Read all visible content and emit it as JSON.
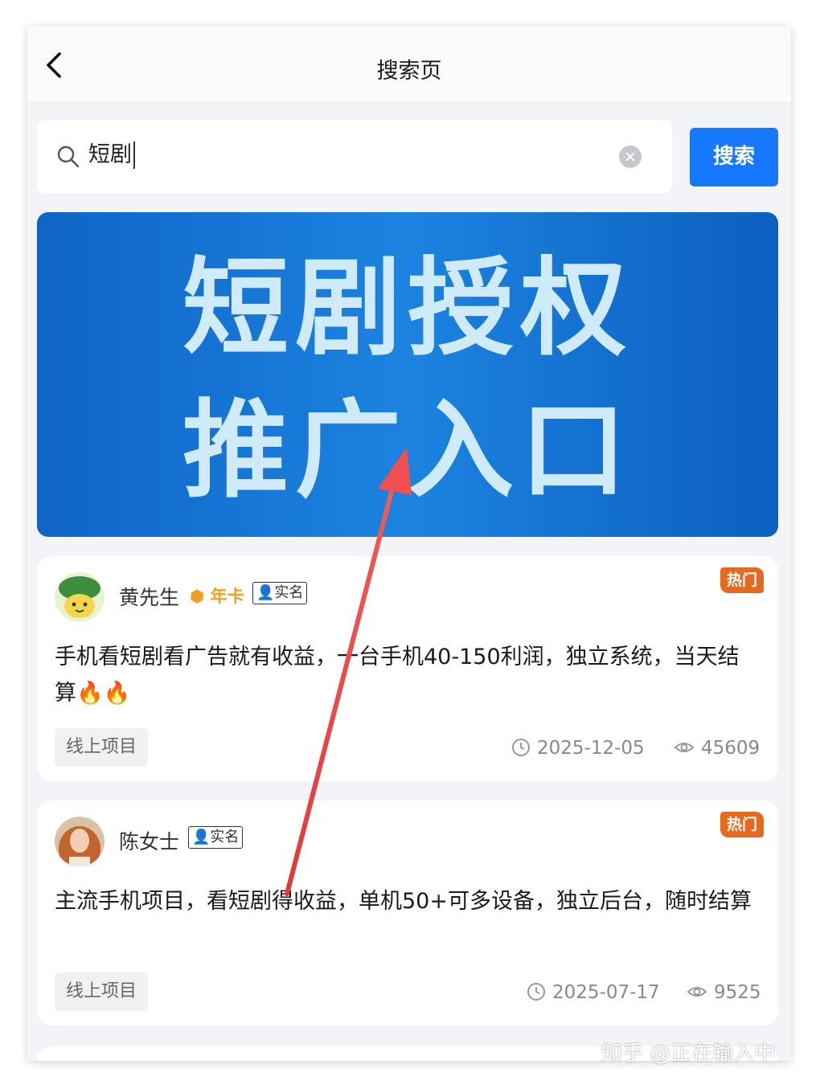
{
  "header": {
    "title": "搜索页"
  },
  "search": {
    "value": "短剧",
    "button_label": "搜索"
  },
  "banner": {
    "line1": "短剧授权",
    "line2": "推广入口"
  },
  "posts": [
    {
      "author": "黄先生",
      "membership": "年卡",
      "verified": "实名",
      "hot": "热门",
      "title": "手机看短剧看广告就有收益，一台手机40-150利润，独立系统，当天结算🔥🔥",
      "tag": "线上项目",
      "date": "2025-12-05",
      "views": "45609"
    },
    {
      "author": "陈女士",
      "verified": "实名",
      "hot": "热门",
      "title": "主流手机项目，看短剧得收益，单机50+可多设备，独立后台，随时结算",
      "tag": "线上项目",
      "date": "2025-07-17",
      "views": "9525"
    }
  ],
  "watermark": "知乎 @正在输入中",
  "colors": {
    "accent": "#1677ff",
    "hot": "#e56a1e",
    "banner": "#1577d6",
    "annotation_arrow": "#ef4f4f"
  },
  "icons": [
    "back-chevron-icon",
    "search-icon",
    "clear-icon",
    "crown-icon",
    "person-icon",
    "clock-icon",
    "eye-icon"
  ]
}
